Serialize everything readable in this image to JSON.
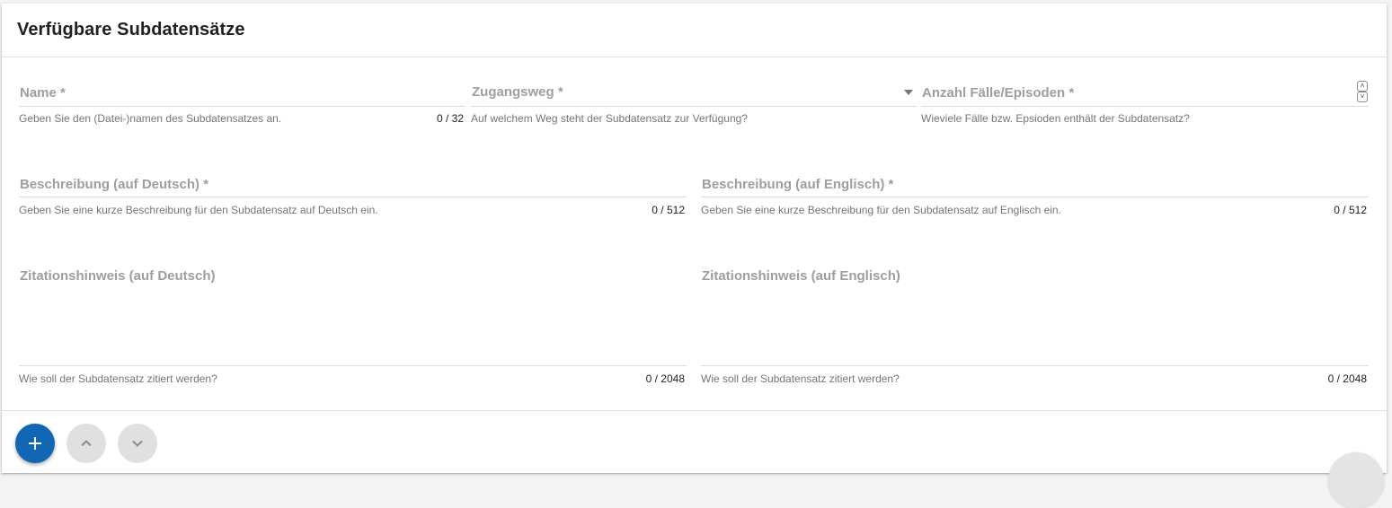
{
  "card": {
    "title": "Verfügbare Subdatensätze"
  },
  "fields": {
    "name": {
      "label": "Name *",
      "hint": "Geben Sie den (Datei-)namen des Subdatensatzes an.",
      "counter": "0 / 32"
    },
    "zugangsweg": {
      "label": "Zugangsweg *",
      "hint": "Auf welchem Weg steht der Subdatensatz zur Verfügung?"
    },
    "anzahl": {
      "label": "Anzahl Fälle/Episoden *",
      "hint": "Wieviele Fälle bzw. Epsioden enthält der Subdatensatz?"
    },
    "beschreibung_de": {
      "label": "Beschreibung (auf Deutsch) *",
      "hint": "Geben Sie eine kurze Beschreibung für den Subdatensatz auf Deutsch ein.",
      "counter": "0 / 512"
    },
    "beschreibung_en": {
      "label": "Beschreibung (auf Englisch) *",
      "hint": "Geben Sie eine kurze Beschreibung für den Subdatensatz auf Englisch ein.",
      "counter": "0 / 512"
    },
    "zitation_de": {
      "label": "Zitationshinweis (auf Deutsch)",
      "hint": "Wie soll der Subdatensatz zitiert werden?",
      "counter": "0 / 2048"
    },
    "zitation_en": {
      "label": "Zitationshinweis (auf Englisch)",
      "hint": "Wie soll der Subdatensatz zitiert werden?",
      "counter": "0 / 2048"
    }
  },
  "footer": {
    "add_icon": "plus-icon",
    "up_icon": "chevron-up-icon",
    "down_icon": "chevron-down-icon"
  },
  "colors": {
    "primary": "#1167b3",
    "disabled_button": "#e0e0e0",
    "label": "#9e9e9e",
    "hint": "#757575",
    "title": "#212121"
  }
}
